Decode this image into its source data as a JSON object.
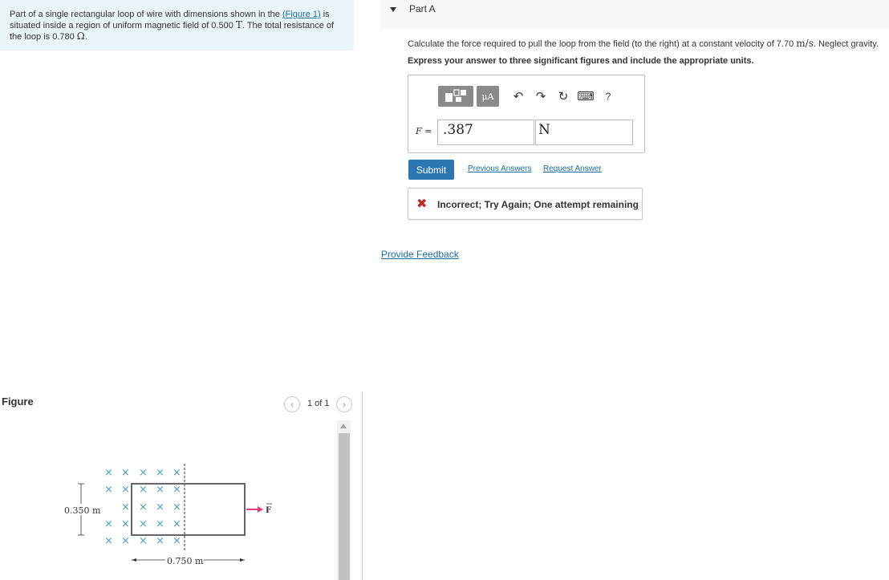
{
  "problem": {
    "text_before": "Part of a single rectangular loop of wire with dimensions shown in the ",
    "figure_link": "(Figure 1)",
    "text_mid1": " is situated inside a region of uniform magnetic field of 0.500 ",
    "field_unit": "T",
    "text_mid2": ". The total resistance of the loop is 0.780 ",
    "resistance_unit": "Ω",
    "text_end": "."
  },
  "figure_panel": {
    "label": "Figure",
    "pager_text": "1 of 1",
    "prev_icon": "‹",
    "next_icon": "›",
    "diagram": {
      "height_label": "0.350 m",
      "width_label": "0.750 m",
      "force_label": "F",
      "field_mark": "×",
      "arrow_color": "#e0407a",
      "field_mark_color": "#4a9fd6"
    }
  },
  "part": {
    "title": "Part A"
  },
  "question": {
    "text_before": "Calculate the force required to pull the loop from the field (to the right) at a constant velocity of 7.70 ",
    "velocity_unit": "m/s",
    "text_after": ". Neglect gravity.",
    "instruction": "Express your answer to three significant figures and include the appropriate units."
  },
  "toolbar": {
    "units_label": "μA",
    "icons": [
      "templates-icon",
      "units-icon",
      "undo-icon",
      "redo-icon",
      "reset-icon",
      "keyboard-icon",
      "help-icon"
    ],
    "undo_glyph": "↶",
    "redo_glyph": "↷",
    "reset_glyph": "↻",
    "keyboard_glyph": "⌨",
    "help_glyph": "?"
  },
  "answer": {
    "label": "F =",
    "value": ".387",
    "units": "N"
  },
  "actions": {
    "submit_label": "Submit",
    "previous_answers_label": "Previous Answers",
    "request_answer_label": "Request Answer"
  },
  "feedback": {
    "icon": "✖",
    "text": "Incorrect; Try Again; One attempt remaining"
  },
  "provide_feedback_label": "Provide Feedback",
  "colors": {
    "problem_bg": "#e9f5f9",
    "link": "#1a6da6",
    "submit_bg": "#2a77b4",
    "error": "#c0262d"
  }
}
